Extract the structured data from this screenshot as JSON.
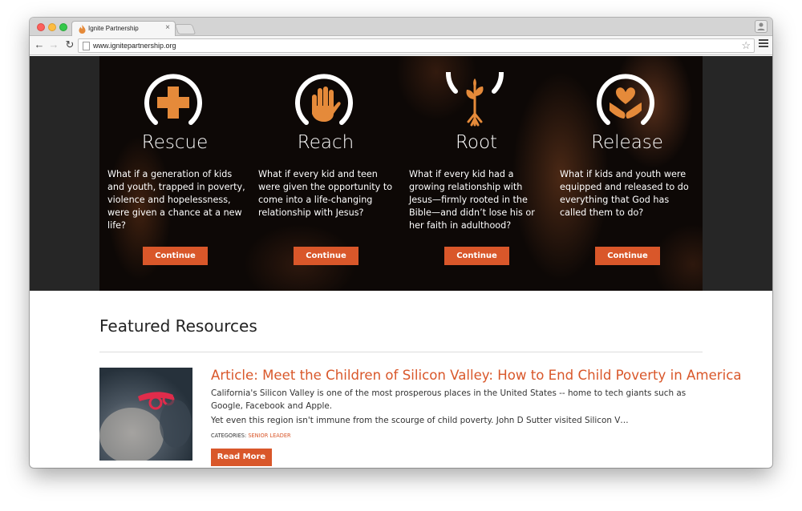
{
  "browser": {
    "tab_title": "Ignite Partnership",
    "url": "www.ignitepartnership.org"
  },
  "hero": {
    "pillars": [
      {
        "title": "Rescue",
        "description": "What if a generation of kids and youth, trapped in poverty, violence and hopelessness, were given a chance at a new life?",
        "button": "Continue",
        "icon": "cross-icon"
      },
      {
        "title": "Reach",
        "description": "What if every kid and teen were given the opportunity to come into a life-changing relationship with Jesus?",
        "button": "Continue",
        "icon": "hand-icon"
      },
      {
        "title": "Root",
        "description": "What if every kid had a growing relationship with Jesus—firmly rooted in the Bible—and didn’t lose his or her faith in adulthood?",
        "button": "Continue",
        "icon": "sprout-icon"
      },
      {
        "title": "Release",
        "description": "What if kids and youth were equipped and released to do everything that God has called them to do?",
        "button": "Continue",
        "icon": "heart-hands-icon"
      }
    ]
  },
  "featured": {
    "heading": "Featured Resources",
    "article": {
      "title": "Article: Meet the Children of Silicon Valley: How to End Child Poverty in America",
      "paragraph1": "California's Silicon Valley is one of the most prosperous places in the United States -- home to tech giants such as Google, Facebook and Apple.",
      "paragraph2": "Yet even this region isn't immune from the scourge of child poverty. John D Sutter visited Silicon V…",
      "categories_label": "CATEGORIES:",
      "category": "SENIOR LEADER",
      "read_more": "Read More"
    }
  },
  "colors": {
    "accent": "#d9572a",
    "icon_orange": "#e58a3a",
    "hero_bg": "#0d0806"
  }
}
